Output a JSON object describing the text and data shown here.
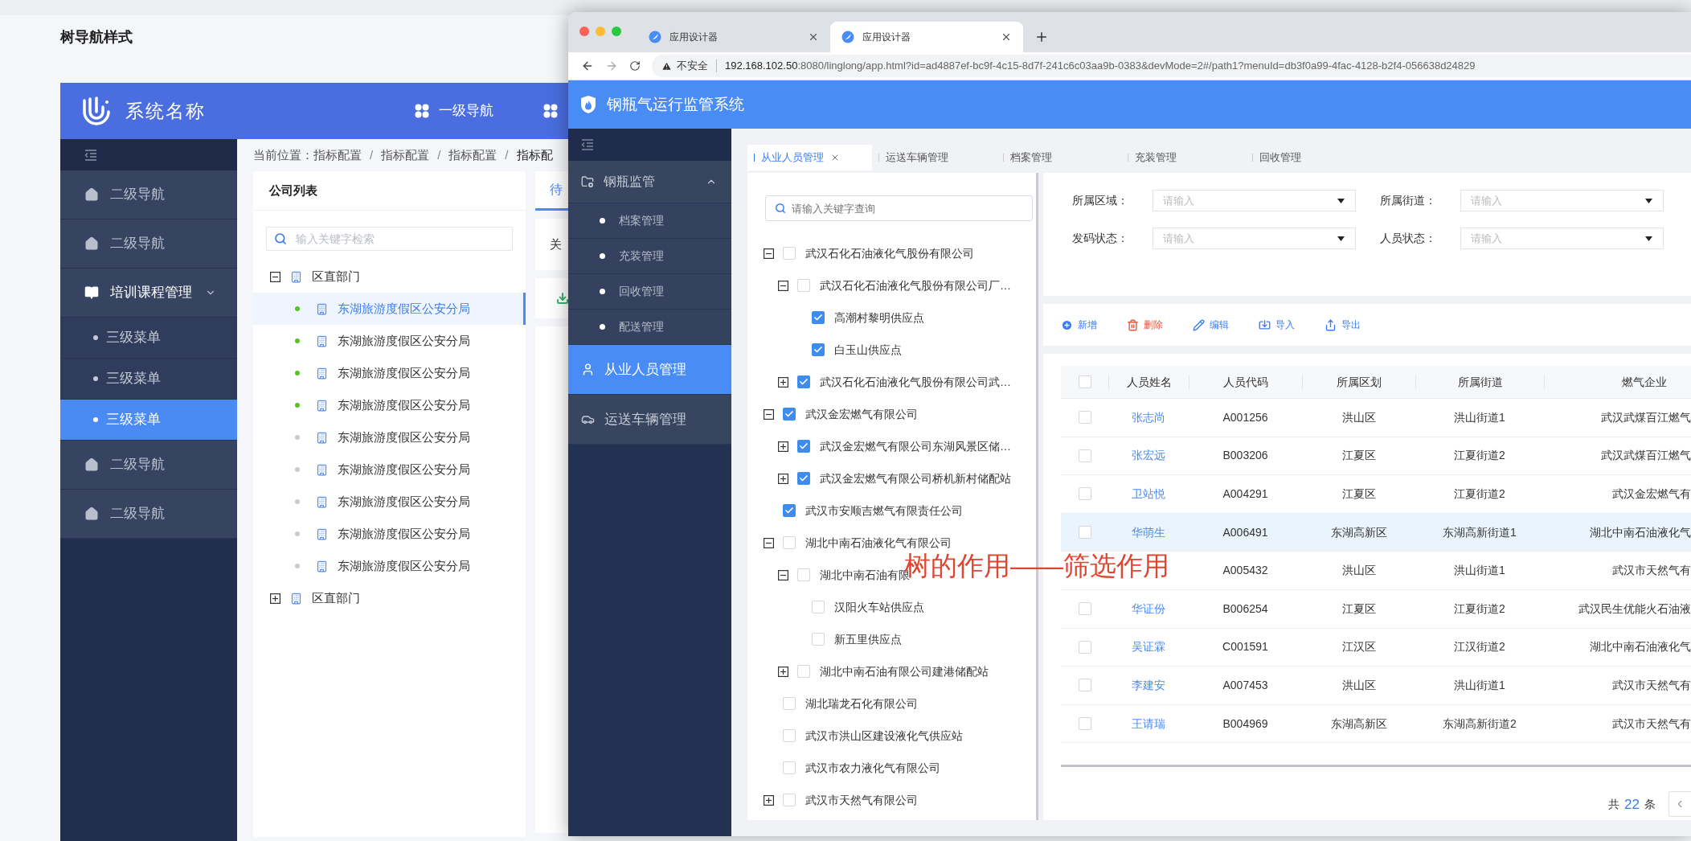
{
  "page": {
    "title": "树导航样式"
  },
  "app": {
    "brand": "系统名称",
    "top_nav": [
      {
        "label": "一级导航"
      }
    ],
    "sidebar": [
      {
        "kind": "nav",
        "label": "二级导航",
        "selected": false
      },
      {
        "kind": "nav",
        "label": "二级导航",
        "selected": false
      },
      {
        "kind": "group",
        "label": "培训课程管理",
        "expanded": true,
        "selected": false
      },
      {
        "kind": "sub",
        "label": "三级菜单",
        "selected": false
      },
      {
        "kind": "sub",
        "label": "三级菜单",
        "selected": false
      },
      {
        "kind": "sub",
        "label": "三级菜单",
        "selected": true
      },
      {
        "kind": "nav",
        "label": "二级导航",
        "selected": false
      },
      {
        "kind": "nav",
        "label": "二级导航",
        "selected": false
      }
    ],
    "breadcrumb": {
      "label": "当前位置：",
      "separator": "/",
      "items": [
        "指标配置",
        "指标配置",
        "指标配置",
        "指标配"
      ]
    },
    "company_list": {
      "title": "公司列表",
      "search_placeholder": "输入关键字检索",
      "tree": [
        {
          "label": "区直部门",
          "expanded": true,
          "children": [
            {
              "label": "东湖旅游度假区公安分局",
              "selected": true,
              "color": "#52c41a"
            },
            {
              "label": "东湖旅游度假区公安分局",
              "selected": false,
              "color": "#52c41a"
            },
            {
              "label": "东湖旅游度假区公安分局",
              "selected": false,
              "color": "#52c41a"
            },
            {
              "label": "东湖旅游度假区公安分局",
              "selected": false,
              "color": "#52c41a"
            },
            {
              "label": "东湖旅游度假区公安分局",
              "selected": false,
              "color": "#c8ccd4"
            },
            {
              "label": "东湖旅游度假区公安分局",
              "selected": false,
              "color": "#c8ccd4"
            },
            {
              "label": "东湖旅游度假区公安分局",
              "selected": false,
              "color": "#c8ccd4"
            },
            {
              "label": "东湖旅游度假区公安分局",
              "selected": false,
              "color": "#c8ccd4"
            },
            {
              "label": "东湖旅游度假区公安分局",
              "selected": false,
              "color": "#c8ccd4"
            }
          ]
        },
        {
          "label": "区直部门",
          "expanded": false
        }
      ]
    },
    "side_card": {
      "tab": "待",
      "text": "关"
    }
  },
  "browser": {
    "tabs": [
      {
        "title": "应用设计器",
        "selected": false
      },
      {
        "title": "应用设计器",
        "selected": true
      }
    ],
    "security": "不安全",
    "url_host": "192.168.102.50",
    "url_rest": ":8080/linglong/app.html?id=ad4887ef-bc9f-4c15-8d7f-241c6c03aa9b-0383&devMode=2#/path1?menuId=db3f0a99-4fac-4128-b2f4-056638d24829",
    "app_title": "钢瓶气运行监管系统",
    "sidebar": [
      {
        "kind": "group",
        "label": "钢瓶监管",
        "expanded": true,
        "selected": false
      },
      {
        "kind": "sub",
        "label": "档案管理",
        "selected": false
      },
      {
        "kind": "sub",
        "label": "充装管理",
        "selected": false
      },
      {
        "kind": "sub",
        "label": "回收管理",
        "selected": false
      },
      {
        "kind": "sub",
        "label": "配送管理",
        "selected": false
      },
      {
        "kind": "staff",
        "label": "从业人员管理",
        "selected": true
      },
      {
        "kind": "vehicle",
        "label": "运送车辆管理",
        "selected": false
      }
    ],
    "page_tabs": [
      {
        "label": "从业人员管理",
        "selected": true
      },
      {
        "label": "运送车辆管理",
        "selected": false
      },
      {
        "label": "档案管理",
        "selected": false
      },
      {
        "label": "充装管理",
        "selected": false
      },
      {
        "label": "回收管理",
        "selected": false
      }
    ],
    "tree": {
      "placeholder": "请输入关键字查询",
      "nodes": [
        {
          "label": "武汉石化石油液化气股份有限公司",
          "checked": false,
          "expanded": true,
          "children": [
            {
              "label": "武汉石化石油液化气股份有限公司厂…",
              "checked": false,
              "expanded": true,
              "children": [
                {
                  "label": "高潮村黎明供应点",
                  "checked": true
                },
                {
                  "label": "白玉山供应点",
                  "checked": true
                }
              ]
            },
            {
              "label": "武汉石化石油液化气股份有限公司武…",
              "checked": true,
              "expanded": false
            }
          ]
        },
        {
          "label": "武汉金宏燃气有限公司",
          "checked": true,
          "expanded": true,
          "children": [
            {
              "label": "武汉金宏燃气有限公司东湖风景区储…",
              "checked": true,
              "expanded": false
            },
            {
              "label": "武汉金宏燃气有限公司桥机新村储配站",
              "checked": true,
              "expanded": false
            }
          ]
        },
        {
          "label": "武汉市安顺吉燃气有限责任公司",
          "checked": true
        },
        {
          "label": "湖北中南石油液化气有限公司",
          "checked": false,
          "expanded": true,
          "children": [
            {
              "label": "湖北中南石油有限",
              "checked": false,
              "expanded": true,
              "children": [
                {
                  "label": "汉阳火车站供应点",
                  "checked": false
                },
                {
                  "label": "新五里供应点",
                  "checked": false
                }
              ]
            },
            {
              "label": "湖北中南石油有限公司建港储配站",
              "checked": false,
              "expanded": false
            }
          ]
        },
        {
          "label": "湖北瑞龙石化有限公司",
          "checked": false
        },
        {
          "label": "武汉市洪山区建设液化气供应站",
          "checked": false
        },
        {
          "label": "武汉市农力液化气有限公司",
          "checked": false
        },
        {
          "label": "武汉市天然气有限公司",
          "checked": false,
          "expanded": false
        }
      ]
    },
    "filters": [
      {
        "label": "所属区域：",
        "placeholder": "请输入"
      },
      {
        "label": "所属街道：",
        "placeholder": "请输入"
      },
      {
        "label": "发码状态：",
        "placeholder": "请输入"
      },
      {
        "label": "人员状态：",
        "placeholder": "请输入"
      }
    ],
    "toolbar": [
      {
        "kind": "add",
        "label": "新增"
      },
      {
        "kind": "delete",
        "label": "删除"
      },
      {
        "kind": "edit",
        "label": "编辑"
      },
      {
        "kind": "import",
        "label": "导入"
      },
      {
        "kind": "export",
        "label": "导出"
      }
    ],
    "table": {
      "all_checked": false,
      "columns": [
        "人员姓名",
        "人员代码",
        "所属区划",
        "所属街道",
        "燃气企业"
      ],
      "rows": [
        {
          "checked": false,
          "selected": false,
          "cells": [
            "张志尚",
            "A001256",
            "洪山区",
            "洪山街道1",
            "武汉武煤百江燃气"
          ]
        },
        {
          "checked": false,
          "selected": false,
          "cells": [
            "张宏远",
            "B003206",
            "江夏区",
            "江夏街道2",
            "武汉武煤百江燃气"
          ]
        },
        {
          "checked": false,
          "selected": false,
          "cells": [
            "卫站悦",
            "A004291",
            "江夏区",
            "江夏街道2",
            "武汉金宏燃气有"
          ]
        },
        {
          "checked": false,
          "selected": true,
          "cells": [
            "华萌生",
            "A006491",
            "东湖高新区",
            "东湖高新街道1",
            "湖北中南石油液化气"
          ]
        },
        {
          "selected": false,
          "cells": [
            "",
            "A005432",
            "洪山区",
            "洪山街道1",
            "武汉市天然气有"
          ]
        },
        {
          "checked": false,
          "selected": false,
          "cells": [
            "华证份",
            "B006254",
            "江夏区",
            "江夏街道2",
            "武汉民生优能火石油液"
          ]
        },
        {
          "checked": false,
          "selected": false,
          "cells": [
            "吴证霖",
            "C001591",
            "江汉区",
            "江汉街道2",
            "湖北中南石油液化气"
          ]
        },
        {
          "checked": false,
          "selected": false,
          "cells": [
            "李建安",
            "A007453",
            "洪山区",
            "洪山街道1",
            "武汉市天然气有"
          ]
        },
        {
          "checked": false,
          "selected": false,
          "cells": [
            "王请瑞",
            "B004969",
            "东湖高新区",
            "东湖高新街道2",
            "武汉市天然气有"
          ]
        }
      ]
    },
    "pagination": {
      "prefix": "共",
      "total": "22",
      "suffix": "条"
    },
    "annotation": "树的作用——筛选作用"
  }
}
